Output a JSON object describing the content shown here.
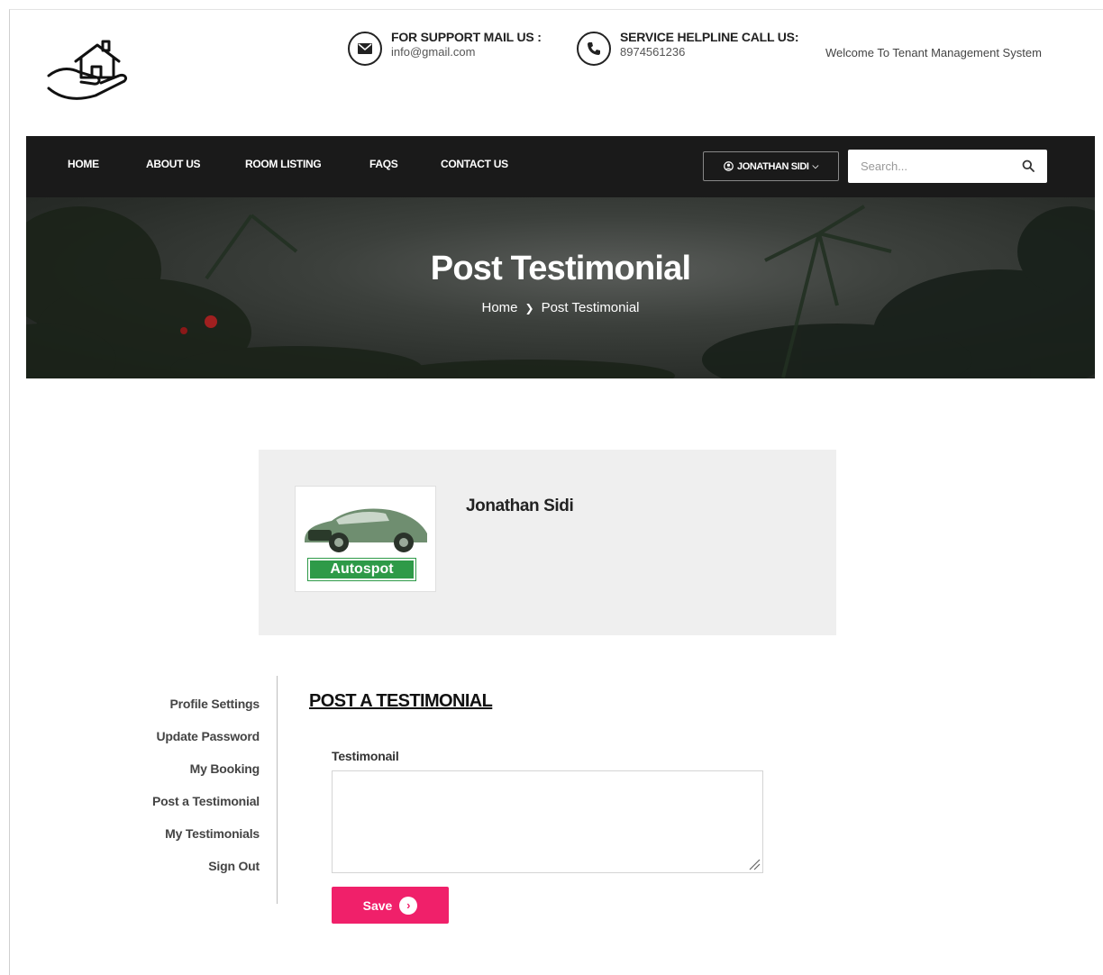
{
  "header": {
    "logo_icon": "house-in-hand-icon",
    "support": {
      "icon": "envelope-icon",
      "title": "FOR SUPPORT MAIL US :",
      "value": "info@gmail.com"
    },
    "helpline": {
      "icon": "phone-icon",
      "title": "SERVICE HELPLINE CALL US:",
      "value": "8974561236"
    },
    "welcome": "Welcome To Tenant Management System"
  },
  "nav": {
    "items": [
      "HOME",
      "ABOUT US",
      "ROOM LISTING",
      "FAQS",
      "CONTACT US"
    ],
    "user_label": "JONATHAN SIDI",
    "user_icon": "user-circle-icon",
    "search_placeholder": "Search...",
    "search_icon": "search-icon"
  },
  "hero": {
    "title": "Post Testimonial",
    "breadcrumb": [
      "Home",
      "Post Testimonial"
    ]
  },
  "profile": {
    "name": "Jonathan Sidi",
    "avatar_badge": "Autospot"
  },
  "side_menu": {
    "items": [
      "Profile Settings",
      "Update Password",
      "My Booking",
      "Post a Testimonial",
      "My Testimonials",
      "Sign Out"
    ]
  },
  "form": {
    "heading": "POST A TESTIMONIAL",
    "field_label": "Testimonail",
    "field_value": "",
    "save_label": "Save"
  },
  "colors": {
    "nav_bg": "#1a1a1a",
    "accent": "#f0206a",
    "badge_green": "#2e9a48",
    "card_bg": "#efefef"
  }
}
